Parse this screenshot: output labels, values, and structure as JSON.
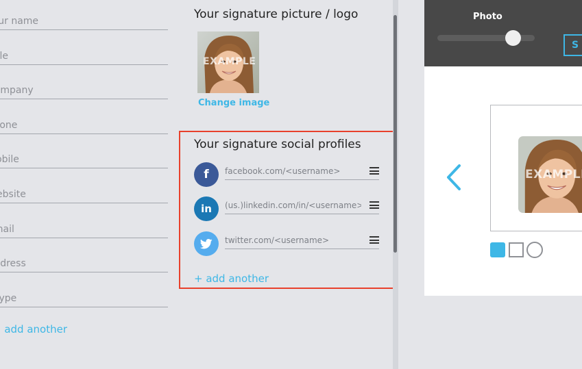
{
  "form": {
    "fields": [
      {
        "id": "name",
        "placeholder": "Your name"
      },
      {
        "id": "title",
        "placeholder": "Title"
      },
      {
        "id": "company",
        "placeholder": "Company"
      },
      {
        "id": "phone",
        "placeholder": "Phone"
      },
      {
        "id": "mobile",
        "placeholder": "Mobile"
      },
      {
        "id": "website",
        "placeholder": "Website"
      },
      {
        "id": "email",
        "placeholder": "Email"
      },
      {
        "id": "address",
        "placeholder": "Address"
      },
      {
        "id": "skype",
        "placeholder": "Skype"
      }
    ],
    "add_another_label": "+ add another"
  },
  "picture": {
    "title": "Your signature picture / logo",
    "watermark": "EXAMPLE",
    "change_label": "Change image"
  },
  "social": {
    "title": "Your signature social profiles",
    "profiles": [
      {
        "network": "facebook",
        "icon": "facebook-icon",
        "glyph": "f",
        "color": "#3b5998",
        "placeholder": "facebook.com/<username>"
      },
      {
        "network": "linkedin",
        "icon": "linkedin-icon",
        "glyph": "in",
        "color": "#1b78b4",
        "placeholder": "(us.)linkedin.com/in/<username>"
      },
      {
        "network": "twitter",
        "icon": "twitter-icon",
        "glyph": "t",
        "color": "#55acee",
        "placeholder": "twitter.com/<username>"
      }
    ],
    "add_another_label": "+ add another"
  },
  "preview": {
    "photo_label": "Photo",
    "photo_slider_level": 0.7,
    "s_button_label": "S",
    "watermark": "EXAMPLE",
    "shapes": [
      "rounded-square",
      "square",
      "circle"
    ],
    "selected_shape": "rounded-square"
  },
  "colors": {
    "accent": "#3eb7e6",
    "highlight": "#e8402b",
    "background": "#e4e5e9",
    "preview_bar": "#484848"
  }
}
